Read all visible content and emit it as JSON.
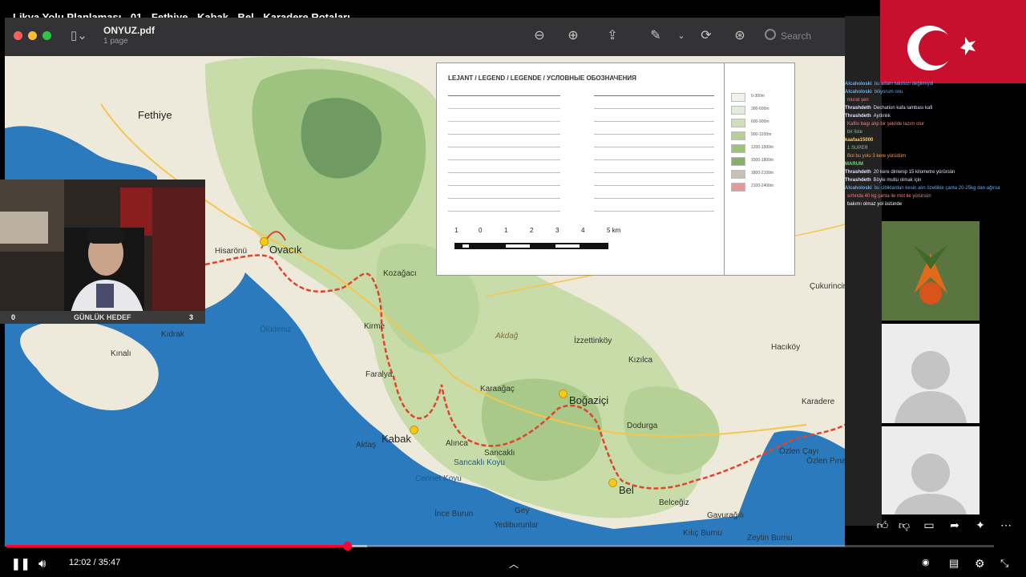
{
  "video": {
    "title": "Likya Yolu Planlaması - 01 - Fethiye - Kabak - Bel - Karadere Rotaları"
  },
  "pdf": {
    "filename": "ONYUZ.pdf",
    "page_count": "1 page",
    "search_placeholder": "Search"
  },
  "map": {
    "places": [
      {
        "label": "Fethiye",
        "cls": "big"
      },
      {
        "label": "Hisarönü",
        "cls": ""
      },
      {
        "label": "Ovacık",
        "cls": "big"
      },
      {
        "label": "Ölüdeniz",
        "cls": "blue"
      },
      {
        "label": "Kıdrak",
        "cls": ""
      },
      {
        "label": "Kınalı",
        "cls": ""
      },
      {
        "label": "Kirme",
        "cls": ""
      },
      {
        "label": "Faralya",
        "cls": ""
      },
      {
        "label": "Kabak",
        "cls": "big"
      },
      {
        "label": "Aktaş",
        "cls": ""
      },
      {
        "label": "Cennet Koyu",
        "cls": "blue"
      },
      {
        "label": "İnce Burun",
        "cls": ""
      },
      {
        "label": "Karaağaç",
        "cls": ""
      },
      {
        "label": "İzzettinköy",
        "cls": ""
      },
      {
        "label": "Kızılca",
        "cls": ""
      },
      {
        "label": "Boğaziçi",
        "cls": "big"
      },
      {
        "label": "Dodurga",
        "cls": ""
      },
      {
        "label": "Hacıköy",
        "cls": ""
      },
      {
        "label": "Karadere",
        "cls": ""
      },
      {
        "label": "Bel",
        "cls": "big"
      },
      {
        "label": "Belceğiz",
        "cls": ""
      },
      {
        "label": "Gavurağılı",
        "cls": ""
      },
      {
        "label": "Sancaklı",
        "cls": ""
      },
      {
        "label": "Alınca",
        "cls": ""
      },
      {
        "label": "Gey",
        "cls": ""
      },
      {
        "label": "Yediburunlar",
        "cls": ""
      },
      {
        "label": "Özlen Çayı",
        "cls": ""
      },
      {
        "label": "Özlen Pınarı",
        "cls": ""
      },
      {
        "label": "Zeytin Burnu",
        "cls": ""
      },
      {
        "label": "Kılıç Burnu",
        "cls": ""
      },
      {
        "label": "Çukurincir",
        "cls": ""
      },
      {
        "label": "Kozağacı",
        "cls": ""
      },
      {
        "label": "Akdağ",
        "cls": "hill"
      },
      {
        "label": "Sancaklı Koyu",
        "cls": "blue"
      }
    ],
    "legend": {
      "title": "LEJANT / LEGEND / LEGENDE / УСЛОВНЫЕ ОБОЗНАЧЕНИЯ",
      "scale_labels": [
        "1",
        "0",
        "1",
        "2",
        "3",
        "4",
        "5 km"
      ],
      "elevation_bands": [
        "0-300m",
        "300-600m",
        "600-900m",
        "900-1200m",
        "1200-1500m",
        "1500-1800m",
        "1800-2100m",
        "2100-2400m"
      ],
      "elevation_colors": [
        "#f2f1ec",
        "#e4ecd8",
        "#cfe0b8",
        "#b6d193",
        "#9fc27b",
        "#89b06a",
        "#c9c1b4",
        "#e39a9a"
      ]
    }
  },
  "webcam": {
    "counter_left": "0",
    "goal_label": "GÜNLÜK HEDEF",
    "counter_right": "3"
  },
  "chat": [
    {
      "user": "Alcaholoski",
      "text": "bu adam takılsızı değilmiydi",
      "color": "#5fb0ff"
    },
    {
      "user": "Alcaholoski",
      "text": "biliyorum onu",
      "color": "#5fb0ff"
    },
    {
      "user": "",
      "text": "murat şen",
      "color": "#ff7a7a"
    },
    {
      "user": "Thrashdeth",
      "text": "Dechation kafa lambası kafi",
      "color": "#e0e0ff"
    },
    {
      "user": "Thrashdeth",
      "text": "Aydınlık",
      "color": "#e0e0ff"
    },
    {
      "user": "",
      "text": "Kafilo bagı alıp bir şekilde lazım olur",
      "color": "#ff7a7a"
    },
    {
      "user": "",
      "text": "bir liste",
      "color": "#7ad07a"
    },
    {
      "user": "kaafaa15000",
      "text": "",
      "color": "#ffcc66"
    },
    {
      "user": "",
      "text": "1 SUPER",
      "color": "#7ad07a"
    },
    {
      "user": "",
      "text": "Bol bu yolu 3 kere yürüdüm",
      "color": "#ff9a3c"
    },
    {
      "user": "MARUM",
      "text": "",
      "color": "#7ad07a"
    },
    {
      "user": "Thrashdeth",
      "text": "20 kere dinlenip 15 kilometre yürürsün",
      "color": "#e0e0ff"
    },
    {
      "user": "Thrashdeth",
      "text": "Böyle mutlu olmak için",
      "color": "#e0e0ff"
    },
    {
      "user": "Alcaholoski",
      "text": "bu cibiklardan kesin alın özellikle çanta 20-25kg dan ağırsa",
      "color": "#5fb0ff"
    },
    {
      "user": "",
      "text": "sırtında 40 kg çanta ile mot ile yürürsün",
      "color": "#ff7a7a"
    },
    {
      "user": "",
      "text": "bakımı olmaz yol üstünde",
      "color": "#ffffff"
    }
  ],
  "player": {
    "current_time": "12:02",
    "separator": " / ",
    "duration": "35:47",
    "progress": 0.345,
    "buffered": 0.365
  },
  "colors": {
    "progress": "#ff0033",
    "route": "#e0452b"
  }
}
